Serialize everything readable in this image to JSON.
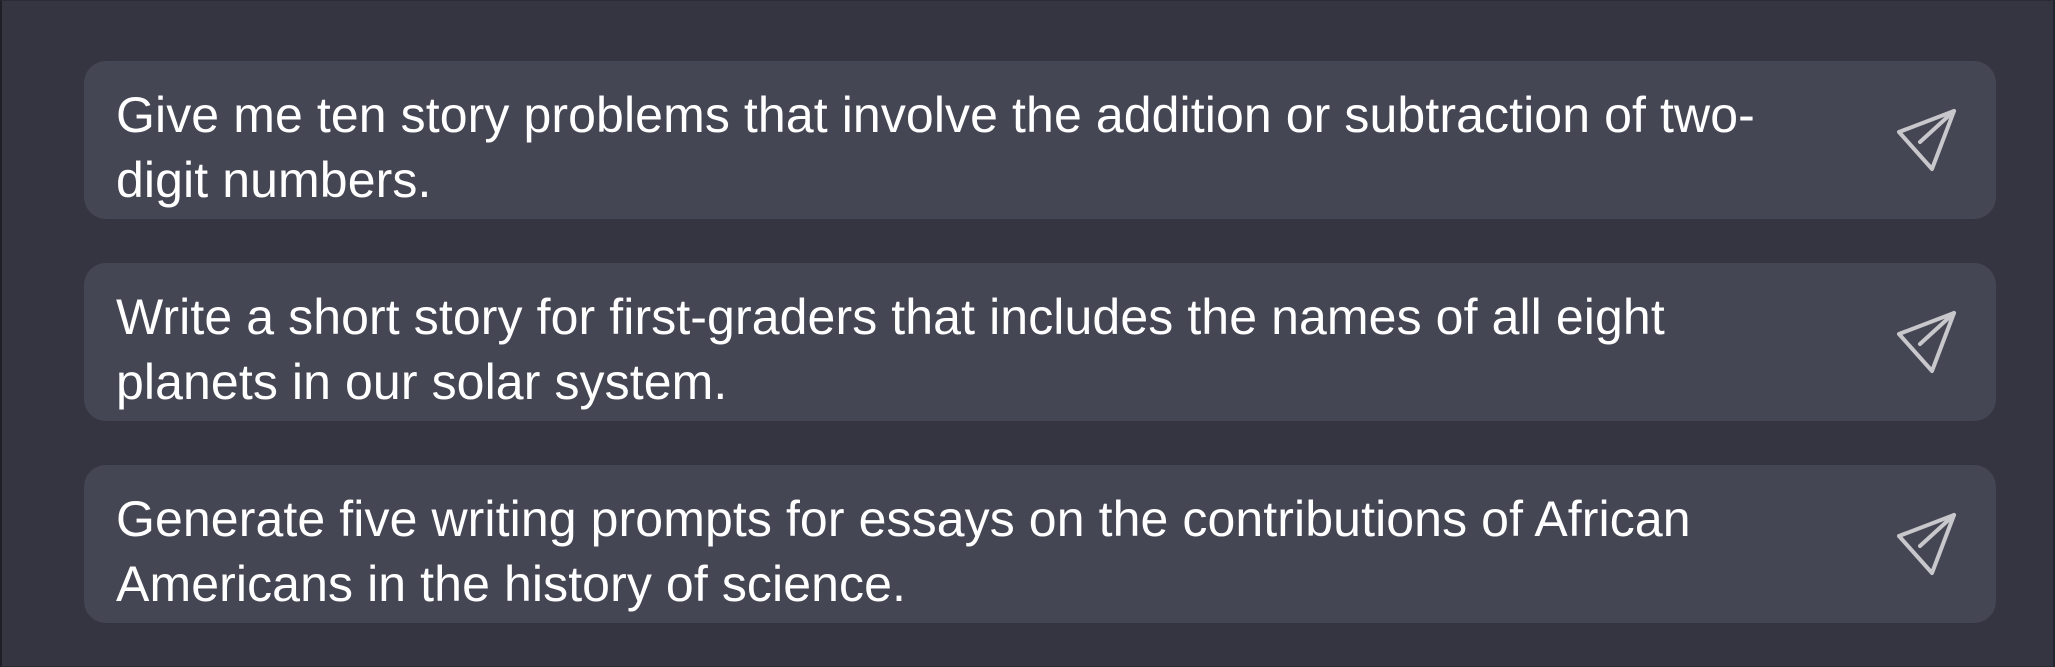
{
  "prompts": [
    {
      "text": "Give me ten story problems that involve the addition or subtraction of two-digit numbers.",
      "action_icon": "send-icon"
    },
    {
      "text": "Write a short story for first-graders that includes the names of all eight planets in our solar system.",
      "action_icon": "send-icon"
    },
    {
      "text": "Generate five writing prompts for essays on the contributions of African Americans in the history of science.",
      "action_icon": "send-icon"
    }
  ],
  "theme": {
    "background": "#343540",
    "card_background": "#454654",
    "text_color": "#ffffff",
    "icon_color": "#c8c8cc"
  }
}
